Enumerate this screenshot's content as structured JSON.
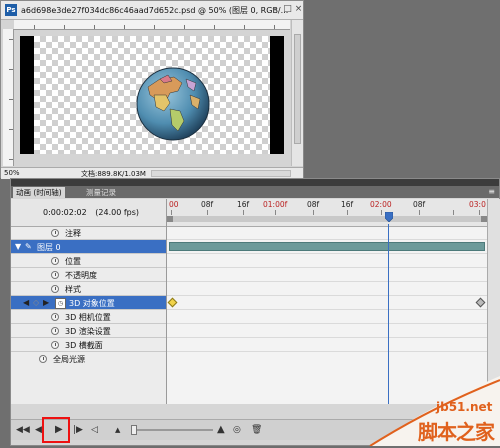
{
  "document": {
    "title": "a6d698e3de27f034dc86c46aad7d652c.psd @ 50% (图层 0, RGB/...",
    "ps_icon": "Ps",
    "zoom": "50%",
    "info": "文档:889.8K/1.03M",
    "ruler_left_label": "50%"
  },
  "panel": {
    "tabs": [
      {
        "label": "动画 (时间轴)"
      },
      {
        "label": "测量记录"
      }
    ],
    "current_time": "0:00:02:02",
    "fps": "(24.00 fps)",
    "ruler_labels": [
      "00",
      "08f",
      "16f",
      "01:00f",
      "08f",
      "16f",
      "02:00",
      "08f",
      "03:0"
    ],
    "rows": [
      {
        "label": "注释"
      },
      {
        "label": "图层 0"
      },
      {
        "label": "位置"
      },
      {
        "label": "不透明度"
      },
      {
        "label": "样式"
      },
      {
        "label": "3D 对象位置"
      },
      {
        "label": "3D 相机位置"
      },
      {
        "label": "3D 渲染设置"
      },
      {
        "label": "3D 横截面"
      },
      {
        "label": "全局光源"
      }
    ]
  },
  "watermark": {
    "domain": "jb51.net",
    "name": "脚本之家"
  },
  "colors": {
    "selection": "#3a6fc3",
    "layer_bar": "#6c9a9a",
    "highlight": "#e11111",
    "watermark": "#e0611d"
  }
}
